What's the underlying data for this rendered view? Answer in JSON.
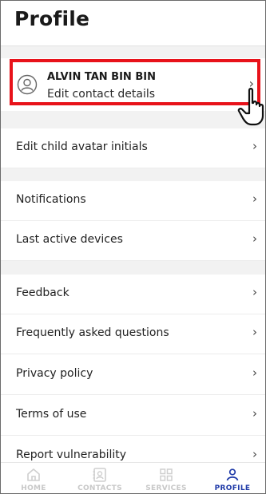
{
  "header": {
    "title": "Profile"
  },
  "profile": {
    "name": "ALVIN TAN BIN BIN",
    "subtitle": "Edit contact details"
  },
  "menu": {
    "edit_child_avatar": "Edit child avatar initials",
    "notifications": "Notifications",
    "last_active_devices": "Last active devices",
    "feedback": "Feedback",
    "faq": "Frequently asked questions",
    "privacy": "Privacy policy",
    "terms": "Terms of use",
    "report": "Report vulnerability",
    "chevron": "›"
  },
  "tabs": {
    "home": "HOME",
    "contacts": "CONTACTS",
    "services": "SERVICES",
    "profile": "PROFILE"
  },
  "colors": {
    "highlight": "#e8121a",
    "active_tab": "#1f3aa8",
    "inactive_tab": "#c8c8c8"
  },
  "icons": {
    "avatar": "user-circle-icon",
    "pointer": "hand-pointer-icon",
    "home": "home-icon",
    "contacts": "contacts-icon",
    "services": "grid-icon",
    "profile": "person-icon"
  }
}
